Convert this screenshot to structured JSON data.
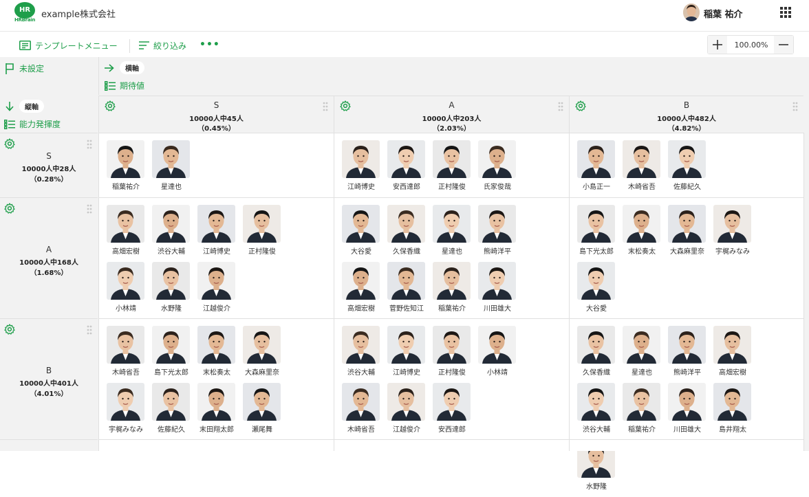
{
  "header": {
    "logo_top": "HR",
    "logo_bottom": "HRBrain",
    "company": "example株式会社",
    "user_name": "稲葉 祐介"
  },
  "toolbar": {
    "template_menu": "テンプレートメニュー",
    "filter": "絞り込み",
    "more": "•••",
    "zoom_value": "100.00%"
  },
  "axes": {
    "unset": "未設定",
    "horizontal_tag": "横軸",
    "horizontal_label": "期待値",
    "vertical_tag": "縦軸",
    "vertical_label": "能力発揮度"
  },
  "columns": [
    {
      "grade": "S",
      "count": "10000人中45人",
      "pct": "（0.45%）"
    },
    {
      "grade": "A",
      "count": "10000人中203人",
      "pct": "（2.03%）"
    },
    {
      "grade": "B",
      "count": "10000人中482人",
      "pct": "（4.82%）"
    }
  ],
  "rows": [
    {
      "grade": "S",
      "count": "10000人中28人",
      "pct": "（0.28%）"
    },
    {
      "grade": "A",
      "count": "10000人中168人",
      "pct": "（1.68%）"
    },
    {
      "grade": "B",
      "count": "10000人中401人",
      "pct": "（4.01%）"
    }
  ],
  "cells": [
    [
      [
        "稲葉祐介",
        "星達也"
      ],
      [
        "江崎博史",
        "安西達郎",
        "正村隆俊",
        "氏家俊哉"
      ],
      [
        "小島正一",
        "木崎省吾",
        "佐藤紀久"
      ]
    ],
    [
      [
        "高畑宏樹",
        "渋谷大輔",
        "江崎博史",
        "正村隆俊",
        "小林靖",
        "水野隆",
        "江越俊介"
      ],
      [
        "大谷愛",
        "久保香織",
        "星達也",
        "熊崎洋平",
        "高畑宏樹",
        "菅野佐知江",
        "稲葉祐介",
        "川田雄大"
      ],
      [
        "島下光太郎",
        "末松奏太",
        "大森麻里奈",
        "宇梶みなみ",
        "大谷愛"
      ]
    ],
    [
      [
        "木崎省吾",
        "島下光太郎",
        "末松奏太",
        "大森麻里奈",
        "宇梶みなみ",
        "佐藤紀久",
        "末田翔太郎",
        "瀬尾舞"
      ],
      [
        "渋谷大輔",
        "江崎博史",
        "正村隆俊",
        "小林靖",
        "木崎省吾",
        "江越俊介",
        "安西達郎"
      ],
      [
        "久保香織",
        "星達也",
        "熊崎洋平",
        "高畑宏樹",
        "渋谷大輔",
        "稲葉祐介",
        "川田雄大",
        "島井翔太",
        "水野隆"
      ]
    ]
  ],
  "colors": {
    "accent": "#1e9e4a",
    "grid_bg": "#f2f2f2",
    "cell_bg": "#ffffff"
  }
}
